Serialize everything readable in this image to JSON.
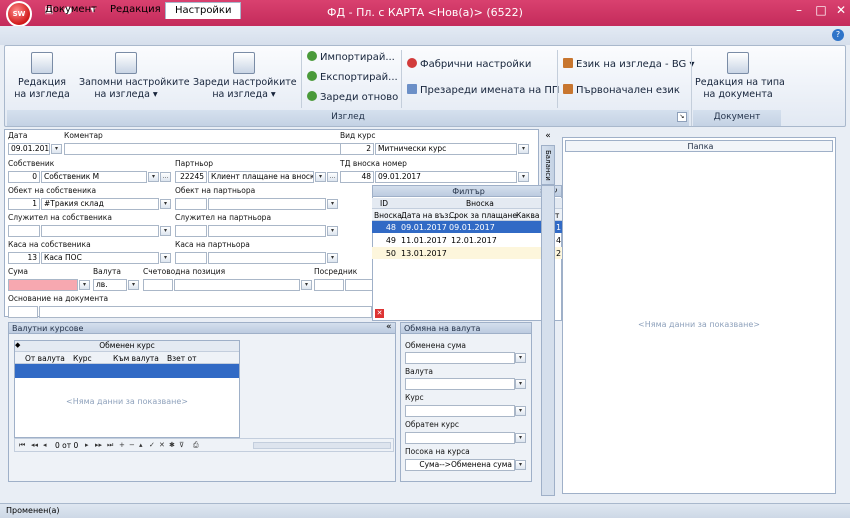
{
  "window": {
    "title": "ФД - Пл. с КАРТА <Нов(а)> (6522)",
    "app_logo": "SW",
    "qat_icons": [
      "save-icon",
      "record-icon",
      "dropdown-arrow-icon"
    ],
    "controls": [
      "minimize-icon",
      "maximize-icon",
      "close-icon"
    ]
  },
  "tabs": [
    {
      "label": "Документ"
    },
    {
      "label": "Редакция"
    },
    {
      "label": "Настройки"
    }
  ],
  "ribbon": {
    "view_group": {
      "caption": "Изглед",
      "buttons": {
        "edit_view": "Редакция\nна изгледа",
        "save_view": "Запомни настройките\nна изгледа ▾",
        "load_view": "Зареди настройките\nна изгледа ▾",
        "import": "Импортирай...",
        "export": "Експортирай...",
        "reload": "Зареди отново",
        "factory": "Фабрични настройки",
        "reload_names": "Презареди имената на ПП",
        "language": "Език на изгледа - BG",
        "orig_lang": "Първоначален език"
      }
    },
    "document_group": {
      "caption": "Документ",
      "button": "Редакция на типа\nна документа"
    }
  },
  "form": {
    "date_label": "Дата",
    "date_value": "09.01.2017",
    "comment_label": "Коментар",
    "rate_type_label": "Вид курс",
    "rate_type_code": "2",
    "rate_type_value": "Митнически курс",
    "owner_label": "Собственик",
    "owner_code": "0",
    "owner_value": "Собственик М",
    "partner_label": "Партньор",
    "partner_code": "22245",
    "partner_value": "Клиент плащане на вноски",
    "td_label": "ТД вноска номер",
    "td_code": "48",
    "td_value": "09.01.2017",
    "owner_obj_label": "Обект на собственика",
    "owner_obj_code": "1",
    "owner_obj_value": "#Тракия склад",
    "partner_obj_label": "Обект на партньора",
    "owner_emp_label": "Служител на собственика",
    "partner_emp_label": "Служител на партньора",
    "owner_cash_label": "Каса на собственика",
    "owner_cash_code": "13",
    "owner_cash_value": "Каса ПОС",
    "partner_cash_label": "Каса на партньора",
    "sum_label": "Сума",
    "currency_label": "Валута",
    "currency_value": "лв.",
    "account_label": "Счетоводна позиция",
    "broker_label": "Посредник",
    "basis_label": "Основание на документа"
  },
  "filter_popup": {
    "title": "Филтър",
    "id_col": "ID",
    "group_header": "Вноска",
    "columns": [
      "Вноска",
      "Дата на въз...",
      "Срок за плащане",
      "Каква част о"
    ],
    "rows": [
      [
        "48",
        "09.01.2017",
        "09.01.2017",
        "1"
      ],
      [
        "49",
        "11.01.2017",
        "12.01.2017",
        "4"
      ],
      [
        "50",
        "13.01.2017",
        "",
        "2"
      ]
    ],
    "selected_row": 0
  },
  "side_tab": "Баланси",
  "rates_panel": {
    "title": "Валутни курсове",
    "group_header": "Обменен курс",
    "columns": [
      "От валута",
      "Курс",
      "Към валута",
      "Взет от"
    ],
    "empty": "<Няма данни за показване>",
    "pager": "0 от 0"
  },
  "exchange_panel": {
    "title": "Обмяна на валута",
    "fields": [
      "Обменена сума",
      "Валута",
      "Курс",
      "Обратен курс",
      "Посока на курса"
    ],
    "direction_value": "Сума-->Обменена сума"
  },
  "papka_panel": {
    "title": "Папка",
    "empty": "<Няма данни за показване>"
  },
  "status": "Променен(а)",
  "colors": {
    "title_bg": "#c42b5b",
    "selected_row": "#316ac5",
    "sum_field": "#f7a8b0"
  }
}
